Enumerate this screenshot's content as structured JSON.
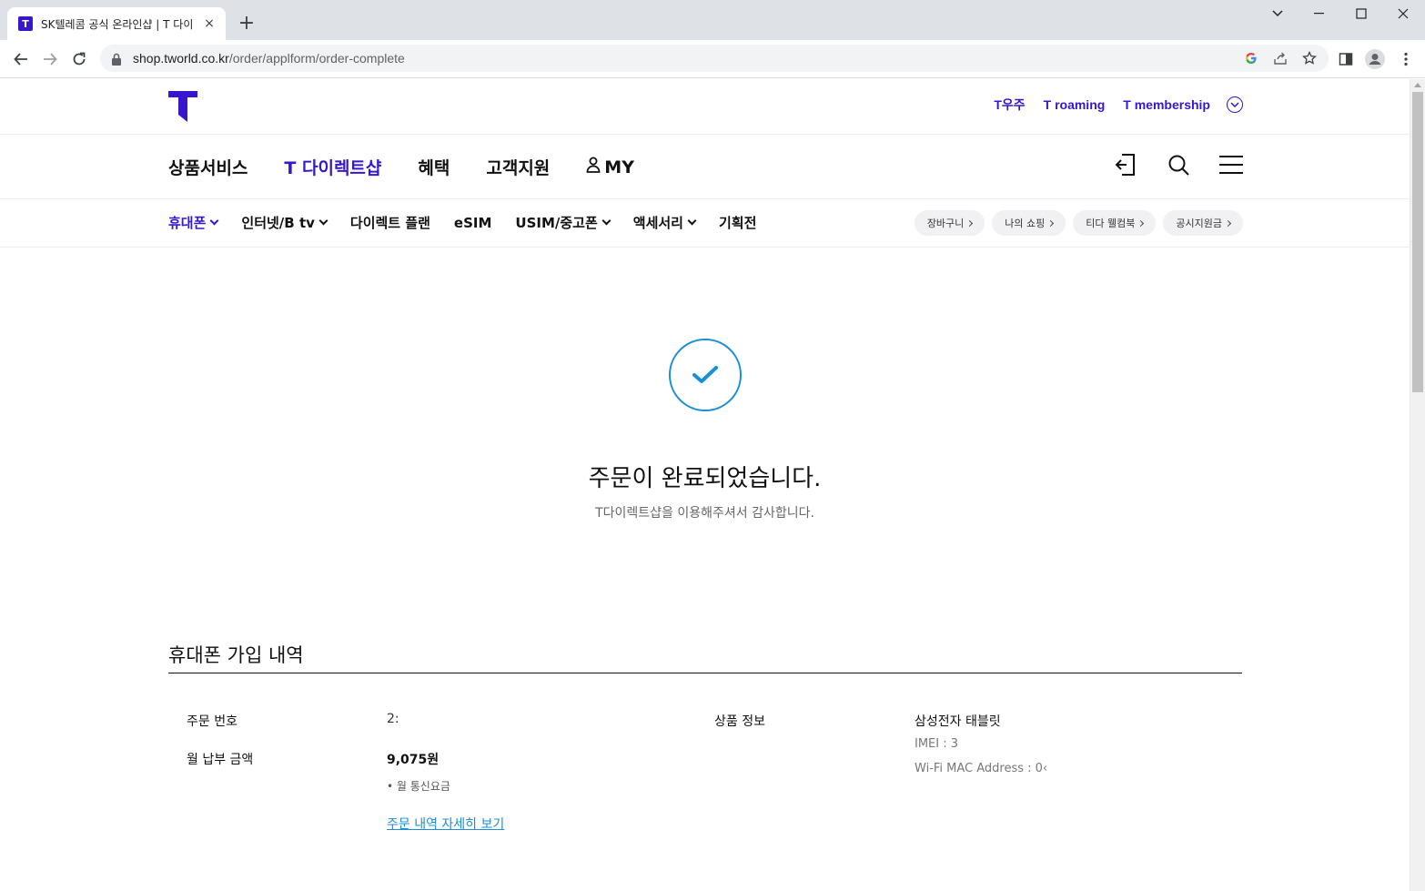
{
  "browser": {
    "tab_favicon": "T",
    "tab_title": "SK텔레콤 공식 온라인샵 | T 다이",
    "tab_close": "×",
    "new_tab": "+",
    "url_host": "shop.tworld.co.kr",
    "url_path": "/order/applform/order-complete"
  },
  "header": {
    "util_links": [
      "T우주",
      "T roaming",
      "T membership"
    ]
  },
  "gnb": {
    "items": [
      "상품서비스",
      "T 다이렉트샵",
      "혜택",
      "고객지원",
      "MY"
    ],
    "active_index": 1
  },
  "lnb": {
    "items": [
      "휴대폰",
      "인터넷/B tv",
      "다이렉트 플랜",
      "eSIM",
      "USIM/중고폰",
      "액세서리",
      "기획전"
    ],
    "pills": [
      "장바구니",
      "나의 쇼핑",
      "티다 웰컴북",
      "공시지원금"
    ]
  },
  "complete": {
    "title": "주문이 완료되었습니다.",
    "subtitle": "T다이렉트샵을 이용해주셔서 감사합니다."
  },
  "order": {
    "section_title": "휴대폰 가입 내역",
    "order_no_label": "주문 번호",
    "order_no_value": "2:",
    "monthly_label": "월 납부 금액",
    "monthly_value": "9,075원",
    "monthly_note": "• 월 통신요금",
    "detail_link": "주문 내역 자세히 보기",
    "product_label": "상품 정보",
    "product_name": "삼성전자 태블릿",
    "imei": "IMEI : 3",
    "wifi_mac": "Wi-Fi MAC Address : 0‹"
  },
  "colors": {
    "brand": "#3617ce",
    "link": "#1a8fd6"
  }
}
